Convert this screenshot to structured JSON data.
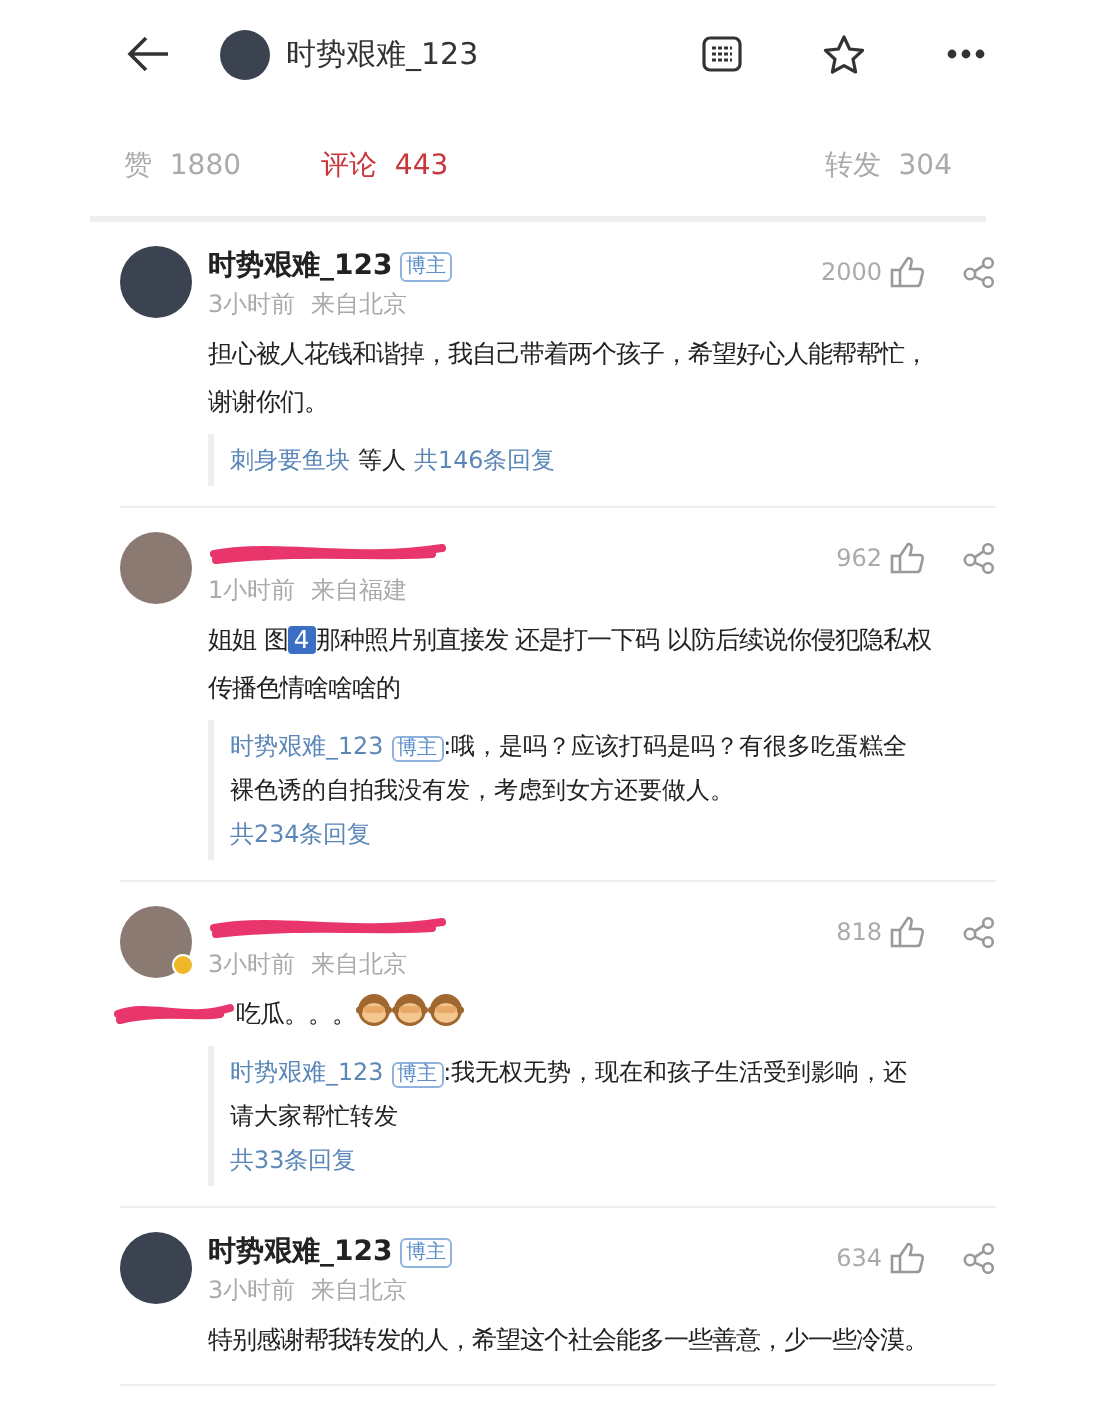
{
  "header": {
    "title": "时势艰难_123"
  },
  "stats": [
    {
      "label": "赞",
      "count": "1880",
      "selected": false
    },
    {
      "label": "评论",
      "count": "443",
      "selected": true
    },
    {
      "label": "转发",
      "count": "304",
      "selected": false
    }
  ],
  "comments": [
    {
      "author": "时势艰难_123",
      "redacted": false,
      "verified": false,
      "badge": "博主",
      "time": "3小时前",
      "location": "来自北京",
      "likes": "2000",
      "text_redacted": false,
      "text": [
        {
          "kind": "text",
          "text": "担心被人花钱和谐掉，我自己带着两个孩子，希望好心人能帮帮忙，谢谢你们。"
        }
      ],
      "replies": {
        "kind": "summary",
        "names": "刺身要鱼块",
        "suffix": "等人",
        "count": "共146条回复"
      }
    },
    {
      "redacted": true,
      "verified": false,
      "time": "1小时前",
      "location": "来自福建",
      "likes": "962",
      "text_redacted": false,
      "text": [
        {
          "kind": "text",
          "text": "姐姐 图"
        },
        {
          "kind": "pic",
          "text": "4"
        },
        {
          "kind": "text",
          "text": "那种照片别直接发 还是打一下码 以防后续说你侵犯隐私权传播色情啥啥啥的"
        }
      ],
      "replies": {
        "kind": "quote",
        "author": "时势艰难_123",
        "badge": "博主",
        "text": ":哦，是吗？应该打码是吗？有很多吃蛋糕全裸色诱的自拍我没有发，考虑到女方还要做人。",
        "count": "共234条回复"
      }
    },
    {
      "redacted": true,
      "verified": true,
      "time": "3小时前",
      "location": "来自北京",
      "likes": "818",
      "text_redacted": true,
      "text": [
        {
          "kind": "text",
          "text": "吃瓜。。。"
        },
        {
          "kind": "monkey"
        },
        {
          "kind": "monkey"
        },
        {
          "kind": "monkey"
        }
      ],
      "replies": {
        "kind": "quote",
        "author": "时势艰难_123",
        "badge": "博主",
        "text": ":我无权无势，现在和孩子生活受到影响，还请大家帮忙转发",
        "count": "共33条回复"
      }
    },
    {
      "author": "时势艰难_123",
      "redacted": false,
      "verified": false,
      "badge": "博主",
      "time": "3小时前",
      "location": "来自北京",
      "likes": "634",
      "text_redacted": false,
      "text": [
        {
          "kind": "text",
          "text": "特别感谢帮我转发的人，希望这个社会能多一些善意，少一些冷漠。"
        }
      ]
    }
  ]
}
